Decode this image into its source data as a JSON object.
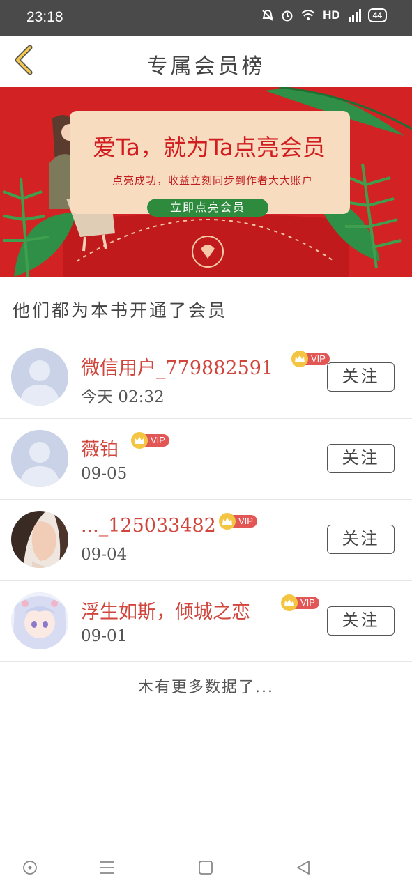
{
  "status_bar": {
    "time": "23:18",
    "network": "HD",
    "signal": "4G",
    "battery": "44"
  },
  "header": {
    "title": "专属会员榜",
    "back_icon": "chevron-left-icon"
  },
  "banner": {
    "headline": "爱Ta，就为Ta点亮会员",
    "subline": "点亮成功，收益立刻同步到作者大大账户",
    "button_label": "立即点亮会员",
    "colors": {
      "background": "#d32223",
      "card": "#f7dcc0",
      "button": "#2e8b3e"
    }
  },
  "section": {
    "title": "他们都为本书开通了会员"
  },
  "members": [
    {
      "name": "微信用户_779882591",
      "time": "今天 02:32",
      "badge": "VIP",
      "follow_label": "关注"
    },
    {
      "name": "薇铂",
      "time": "09-05",
      "badge": "VIP",
      "follow_label": "关注"
    },
    {
      "name": "..._125033482",
      "time": "09-04",
      "badge": "VIP",
      "follow_label": "关注"
    },
    {
      "name": "浮生如斯，倾城之恋",
      "time": "09-01",
      "badge": "VIP",
      "follow_label": "关注"
    }
  ],
  "footer": {
    "no_more": "木有更多数据了..."
  },
  "nav_bar": {
    "icons": [
      "home-circle-icon",
      "menu-icon",
      "square-icon",
      "back-triangle-icon"
    ]
  }
}
